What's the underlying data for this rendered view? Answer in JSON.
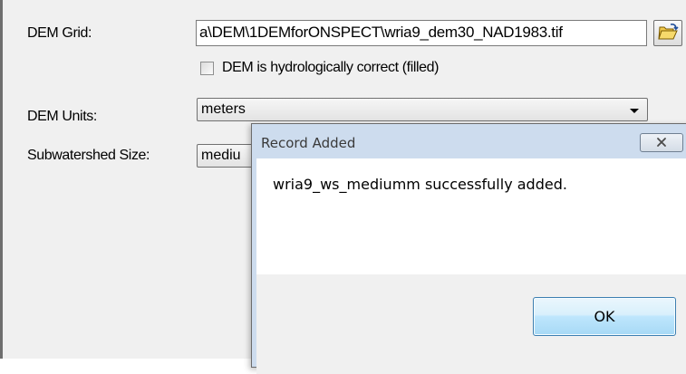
{
  "form": {
    "dem_grid_label": "DEM Grid:",
    "dem_grid_value": "a\\DEM\\1DEMforONSPECT\\wria9_dem30_NAD1983.tif",
    "browse_icon": "open-folder-icon",
    "hydro_checkbox_label": "DEM is hydrologically correct (filled)",
    "hydro_checkbox_checked": false,
    "dem_units_label": "DEM Units:",
    "dem_units_value": "meters",
    "subwatershed_label": "Subwatershed Size:",
    "subwatershed_value": "mediu"
  },
  "dialog": {
    "title": "Record Added",
    "close_icon": "close-icon",
    "message": "wria9_ws_mediumm successfully added.",
    "ok_label": "OK"
  },
  "colors": {
    "dialog_frame": "#cddcee",
    "ok_button_border": "#3c7fb1",
    "form_background": "#f0f0f0"
  }
}
